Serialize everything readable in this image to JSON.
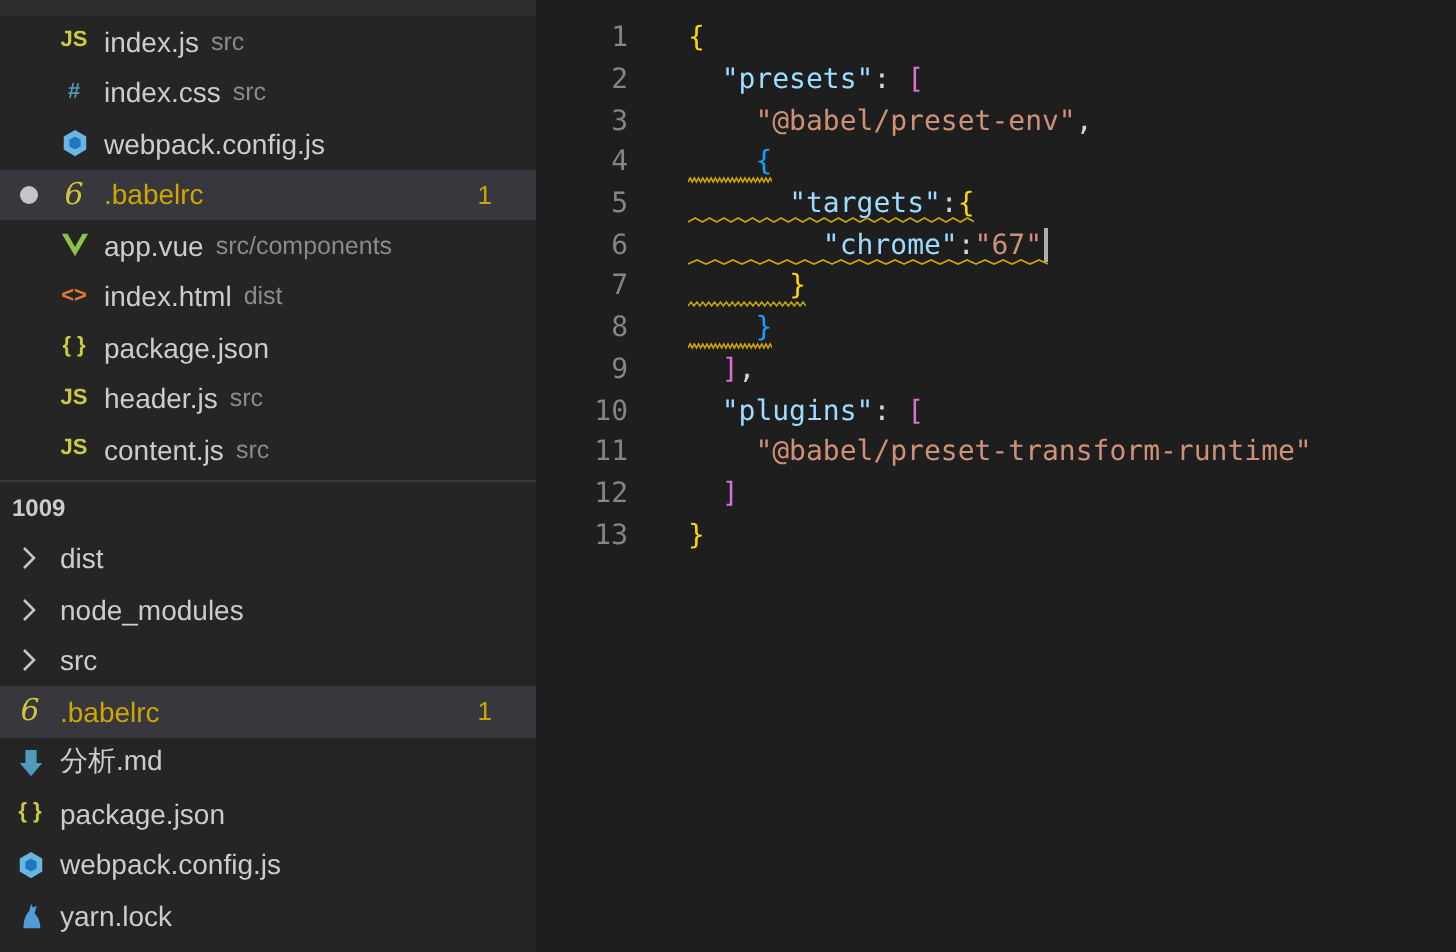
{
  "open_editors": [
    {
      "name": "index.js",
      "path": "src",
      "kind": "js",
      "glyph": "JS",
      "selected": false,
      "unsaved": false
    },
    {
      "name": "index.css",
      "path": "src",
      "kind": "css",
      "glyph": "#",
      "selected": false,
      "unsaved": false
    },
    {
      "name": "webpack.config.js",
      "kind": "webpack",
      "selected": false,
      "unsaved": false
    },
    {
      "name": ".babelrc",
      "kind": "babel",
      "glyph": "6",
      "selected": true,
      "unsaved": true,
      "problems": "1"
    },
    {
      "name": "app.vue",
      "path": "src/components",
      "kind": "vue",
      "selected": false,
      "unsaved": false
    },
    {
      "name": "index.html",
      "path": "dist",
      "kind": "html",
      "glyph": "<>",
      "selected": false,
      "unsaved": false
    },
    {
      "name": "package.json",
      "kind": "json",
      "glyph": "{ }",
      "selected": false,
      "unsaved": false
    },
    {
      "name": "header.js",
      "path": "src",
      "kind": "js",
      "glyph": "JS",
      "selected": false,
      "unsaved": false
    },
    {
      "name": "content.js",
      "path": "src",
      "kind": "js",
      "glyph": "JS",
      "selected": false,
      "unsaved": false
    }
  ],
  "explorer": {
    "title": "1009",
    "items": [
      {
        "name": "dist",
        "kind": "folder",
        "expanded": false,
        "selected": false
      },
      {
        "name": "node_modules",
        "kind": "folder",
        "expanded": false,
        "selected": false
      },
      {
        "name": "src",
        "kind": "folder",
        "expanded": false,
        "selected": false
      },
      {
        "name": ".babelrc",
        "kind": "babel",
        "glyph": "6",
        "selected": true,
        "problems": "1"
      },
      {
        "name": "分析.md",
        "kind": "md",
        "selected": false
      },
      {
        "name": "package.json",
        "kind": "json",
        "glyph": "{ }",
        "selected": false
      },
      {
        "name": "webpack.config.js",
        "kind": "webpack",
        "selected": false
      },
      {
        "name": "yarn.lock",
        "kind": "yarn",
        "selected": false
      }
    ]
  },
  "editor": {
    "lines": [
      {
        "number": "1",
        "warning": false,
        "tokens": [
          {
            "t": "{",
            "kind": "brace1"
          }
        ],
        "children": [
          {
            "number": "2",
            "warning": false,
            "tokens": [
              {
                "t": "\"presets\"",
                "kind": "key"
              },
              {
                "t": ": ",
                "kind": "punct"
              },
              {
                "t": "[",
                "kind": "brace2"
              }
            ],
            "children": [
              {
                "number": "3",
                "warning": false,
                "tokens": [
                  {
                    "t": "\"@babel/preset-env\"",
                    "kind": "string"
                  },
                  {
                    "t": ",",
                    "kind": "punct"
                  }
                ]
              },
              {
                "number": "4",
                "warning": true,
                "tokens": [
                  {
                    "t": "{",
                    "kind": "brace3"
                  }
                ],
                "children": [
                  {
                    "number": "5",
                    "warning": true,
                    "tokens": [
                      {
                        "t": "\"targets\"",
                        "kind": "key"
                      },
                      {
                        "t": ":",
                        "kind": "punct"
                      },
                      {
                        "t": "{",
                        "kind": "brace1"
                      }
                    ],
                    "children": [
                      {
                        "number": "6",
                        "warning": true,
                        "cursor": true,
                        "tokens": [
                          {
                            "t": "\"chrome\"",
                            "kind": "key"
                          },
                          {
                            "t": ":",
                            "kind": "punct"
                          },
                          {
                            "t": "\"67\"",
                            "kind": "string"
                          }
                        ]
                      }
                    ]
                  },
                  {
                    "number": "7",
                    "warning": true,
                    "tokens": [
                      {
                        "t": "}",
                        "kind": "brace1"
                      }
                    ]
                  }
                ]
              },
              {
                "number": "8",
                "warning": true,
                "tokens": [
                  {
                    "t": "}",
                    "kind": "brace3"
                  }
                ]
              }
            ]
          },
          {
            "number": "9",
            "warning": false,
            "tokens": [
              {
                "t": "]",
                "kind": "brace2"
              },
              {
                "t": ",",
                "kind": "punct"
              }
            ]
          },
          {
            "number": "10",
            "warning": false,
            "tokens": [
              {
                "t": "\"plugins\"",
                "kind": "key"
              },
              {
                "t": ": ",
                "kind": "punct"
              },
              {
                "t": "[",
                "kind": "brace2"
              }
            ],
            "children": [
              {
                "number": "11",
                "warning": false,
                "tokens": [
                  {
                    "t": "\"@babel/preset-transform-runtime\"",
                    "kind": "string"
                  }
                ]
              }
            ]
          },
          {
            "number": "12",
            "warning": false,
            "tokens": [
              {
                "t": "]",
                "kind": "brace2"
              }
            ]
          }
        ]
      },
      {
        "number": "13",
        "warning": false,
        "tokens": [
          {
            "t": "}",
            "kind": "brace1"
          }
        ]
      }
    ]
  }
}
